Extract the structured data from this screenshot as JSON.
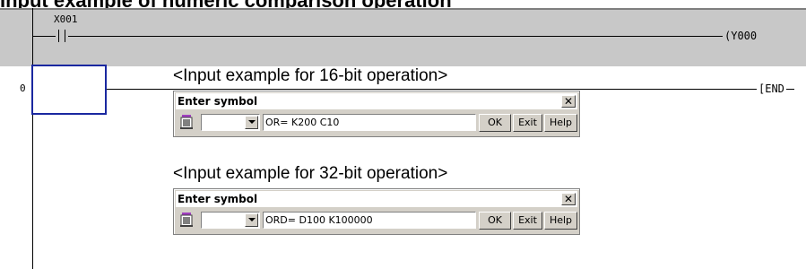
{
  "page": {
    "heading": "Input example of numeric comparison operation"
  },
  "ladder": {
    "rung1": {
      "contact": "X001",
      "coil": "Y000"
    },
    "rung2": {
      "step": "0",
      "end": "END"
    }
  },
  "examples": [
    {
      "caption": "<Input example for 16-bit operation>",
      "dialog": {
        "title": "Enter symbol",
        "close": "✕",
        "input_value": "OR= K200 C10",
        "ok": "OK",
        "exit": "Exit",
        "help": "Help"
      }
    },
    {
      "caption": "<Input example for 32-bit operation>",
      "dialog": {
        "title": "Enter symbol",
        "close": "✕",
        "input_value": "ORD= D100 K100000",
        "ok": "OK",
        "exit": "Exit",
        "help": "Help"
      }
    }
  ]
}
